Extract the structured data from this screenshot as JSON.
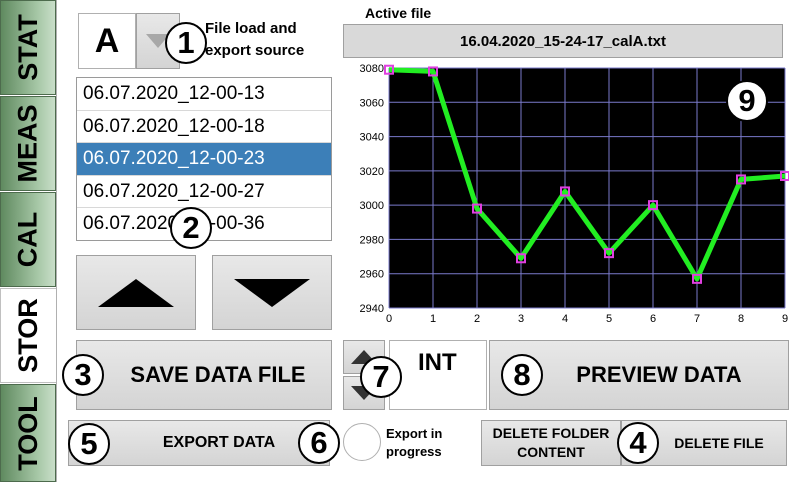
{
  "tabs": [
    {
      "label": "STAT",
      "active": false
    },
    {
      "label": "MEAS",
      "active": false
    },
    {
      "label": "CAL",
      "active": false
    },
    {
      "label": "STOR",
      "active": true
    },
    {
      "label": "TOOL",
      "active": false
    }
  ],
  "source": {
    "letter": "A",
    "label_line1": "File load and",
    "label_line2": "export source"
  },
  "files": [
    "06.07.2020_12-00-13",
    "06.07.2020_12-00-18",
    "06.07.2020_12-00-23",
    "06.07.2020_12-00-27",
    "06.07.2020_12-00-36"
  ],
  "selected_file_index": 2,
  "active_file": {
    "label": "Active file",
    "value": "16.04.2020_15-24-17_calA.txt"
  },
  "buttons": {
    "save": "SAVE DATA FILE",
    "int": "INT",
    "preview": "PREVIEW DATA",
    "export": "EXPORT DATA",
    "export_status_line1": "Export in",
    "export_status_line2": "progress",
    "delete_folder_line1": "DELETE FOLDER",
    "delete_folder_line2": "CONTENT",
    "delete_file": "DELETE FILE"
  },
  "markers": [
    "1",
    "2",
    "3",
    "4",
    "5",
    "6",
    "7",
    "8",
    "9"
  ],
  "colors": {
    "tab_green": "#8fb58f",
    "selected": "#3c7fb8",
    "plot_bg": "#000000",
    "line": "#22ee22",
    "marker": "#e040e0"
  },
  "chart_data": {
    "type": "line",
    "x": [
      0,
      1,
      2,
      3,
      4,
      5,
      6,
      7,
      8,
      9
    ],
    "values": [
      3079,
      3078,
      2998,
      2969,
      3008,
      2972,
      3000,
      2957,
      3015,
      3017
    ],
    "xlim": [
      0,
      9
    ],
    "ylim": [
      2940,
      3080
    ],
    "yticks": [
      2940,
      2960,
      2980,
      3000,
      3020,
      3040,
      3060,
      3080
    ],
    "xticks": [
      0,
      1,
      2,
      3,
      4,
      5,
      6,
      7,
      8,
      9
    ],
    "grid": true
  }
}
